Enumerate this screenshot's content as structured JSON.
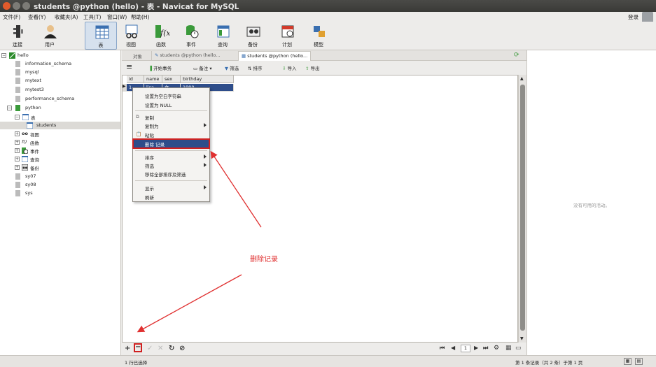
{
  "window": {
    "title": "students @python (hello) - 表 - Navicat for MySQL"
  },
  "menu": {
    "items": [
      "文件(F)",
      "查看(Y)",
      "收藏夹(A)",
      "工具(T)",
      "窗口(W)",
      "帮助(H)"
    ],
    "login": "登录"
  },
  "toolbar": {
    "buttons": [
      "连接",
      "用户",
      "表",
      "视图",
      "函数",
      "事件",
      "查询",
      "备份",
      "计划",
      "模型"
    ],
    "active": "表"
  },
  "sidebar": {
    "items": [
      {
        "label": "hello",
        "level": 0,
        "expanded": true
      },
      {
        "label": "information_schema",
        "level": 1
      },
      {
        "label": "mysql",
        "level": 1
      },
      {
        "label": "mytext",
        "level": 1
      },
      {
        "label": "mytest3",
        "level": 1
      },
      {
        "label": "performance_schema",
        "level": 1
      },
      {
        "label": "python",
        "level": 1,
        "expanded": true
      },
      {
        "label": "表",
        "level": 2,
        "expanded": true
      },
      {
        "label": "students",
        "level": 3,
        "selected": true
      },
      {
        "label": "视图",
        "level": 2
      },
      {
        "label": "函数",
        "level": 2
      },
      {
        "label": "事件",
        "level": 2
      },
      {
        "label": "查询",
        "level": 2
      },
      {
        "label": "备份",
        "level": 2
      },
      {
        "label": "sy07",
        "level": 1
      },
      {
        "label": "sy08",
        "level": 1
      },
      {
        "label": "sys",
        "level": 1
      }
    ]
  },
  "tabs": {
    "objects": "对象",
    "tab1": "students @python (hello...",
    "tab2": "students @python (hello..."
  },
  "subtoolbar": {
    "begin_transaction": "开始事务",
    "memo": "备注",
    "filter": "筛选",
    "sort": "排序",
    "import": "导入",
    "export": "导出"
  },
  "grid": {
    "columns": [
      "id",
      "name",
      "sex",
      "birthday"
    ],
    "rows": [
      [
        "1",
        "lisa",
        "女",
        "1990-..."
      ]
    ]
  },
  "context_menu": {
    "items": [
      {
        "label": "设置为空白字符串"
      },
      {
        "label": "设置为 NULL"
      },
      {
        "separator": true
      },
      {
        "label": "复制"
      },
      {
        "label": "复制为",
        "submenu": true
      },
      {
        "label": "粘贴"
      },
      {
        "label": "删除 记录",
        "highlighted": true
      },
      {
        "separator": true
      },
      {
        "label": "排序",
        "submenu": true
      },
      {
        "label": "筛选",
        "submenu": true
      },
      {
        "label": "移除全部排序及筛选"
      },
      {
        "separator": true
      },
      {
        "label": "显示",
        "submenu": true
      },
      {
        "label": "刷新"
      }
    ]
  },
  "annotation": {
    "text": "删除记录",
    "color": "#e03030"
  },
  "right_panel": {
    "empty_text": "没有可用的活动。"
  },
  "gridnav": {
    "page_input": "1"
  },
  "status": {
    "left": "1 行已选择",
    "right": "第 1 条记录（共 2 条）于第 1 页"
  }
}
